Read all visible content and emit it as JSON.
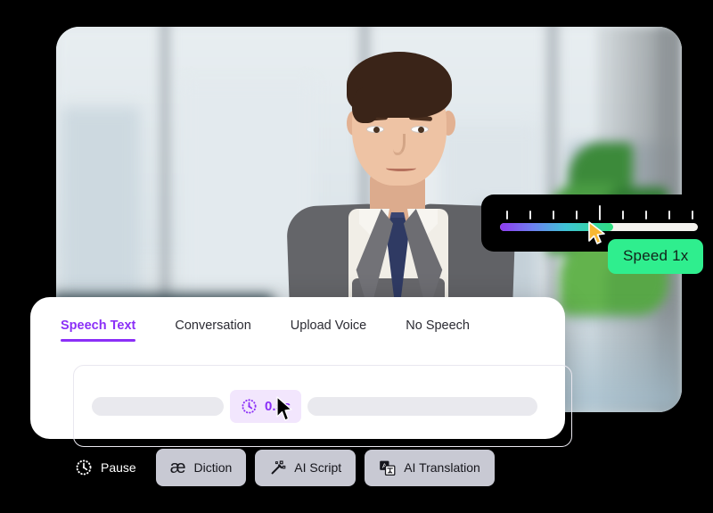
{
  "video": {
    "alt": "blurred office background with businessman in grey suit",
    "scene": "office-window-cityscape"
  },
  "speed_control": {
    "name": "speed-slider",
    "badge_label": "Speed 1x",
    "value": 1,
    "fill_percent": 57,
    "tick_count": 9,
    "major_tick_index": 4,
    "badge_color": "#2fee8e",
    "gradient": [
      "#8f3bf0",
      "#6f7ef0",
      "#3fc3d6",
      "#2ee07f"
    ]
  },
  "speech_panel": {
    "tabs": [
      {
        "label": "Speech Text",
        "active": true
      },
      {
        "label": "Conversation",
        "active": false
      },
      {
        "label": "Upload Voice",
        "active": false
      },
      {
        "label": "No Speech",
        "active": false
      }
    ],
    "accent_color": "#8b2ff7",
    "pause_chip": {
      "label": "0.5s",
      "icon": "clock-dotted-icon",
      "background": "#f2e6fd"
    }
  },
  "toolbar": {
    "items": [
      {
        "label": "Pause",
        "icon": "clock-dotted-icon",
        "style": "plain"
      },
      {
        "label": "Diction",
        "icon": "ae-ligature-icon",
        "style": "filled"
      },
      {
        "label": "AI Script",
        "icon": "magic-wand-icon",
        "style": "filled"
      },
      {
        "label": "AI Translation",
        "icon": "translate-icon",
        "style": "filled"
      }
    ],
    "button_color": "#c8c9d3"
  },
  "cursors": [
    {
      "name": "slider-cursor",
      "color": "#f7b733"
    },
    {
      "name": "panel-cursor",
      "color": "#000000"
    }
  ]
}
